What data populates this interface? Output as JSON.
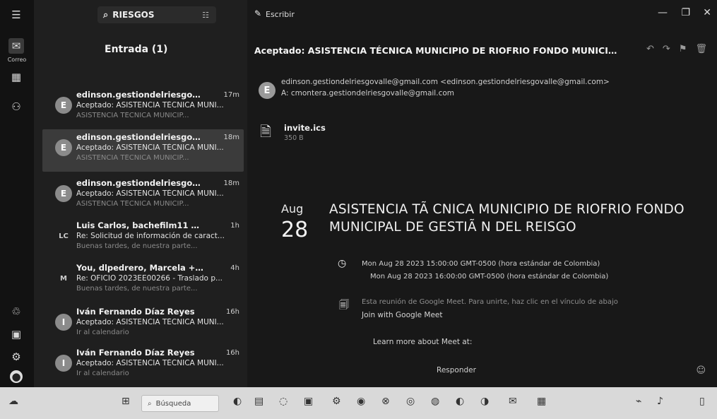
{
  "app": {
    "tab_title": "Escribir",
    "folder_title": "Entrada (1)",
    "rail_label": "Correo"
  },
  "search": {
    "value": "RIESGOS",
    "filter_label": "Filtro"
  },
  "list": [
    {
      "from": "edinson.gestiondelriesgovalle...",
      "time": "17m",
      "subject": "Aceptado: ASISTENCIA TÉCNICA MUNI...",
      "preview": "ASISTENCIA TÉCNICA MUNICIP...",
      "avatar": "E",
      "selected": false
    },
    {
      "from": "edinson.gestiondelriesgovalle...",
      "time": "18m",
      "subject": "Aceptado: ASISTENCIA TÉCNICA MUNI...",
      "preview": "ASISTENCIA TÉCNICA MUNICIP...",
      "avatar": "E",
      "selected": true
    },
    {
      "from": "edinson.gestiondelriesgovall...",
      "time": "18m",
      "subject": "Aceptado: ASISTENCIA TÉCNICA MUNI...",
      "preview": "ASISTENCIA TÉCNICA MUNICIP...",
      "avatar": "E",
      "selected": false
    },
    {
      "from": "Luis Carlos, bachefilm11 + 6",
      "time": "1h",
      "subject": "Re: Solicitud de información de caract...",
      "preview": "Buenas tardes, de nuestra parte...",
      "avatar": "LC",
      "selected": false
    },
    {
      "from": "You, dlpedrero, Marcela + 2",
      "time": "4h",
      "subject": "Re: OFICIO 2023EE00266 - Traslado p...",
      "preview": "Buenas tardes, de nuestra parte...",
      "avatar": "M",
      "selected": false
    },
    {
      "from": "Iván Fernando Díaz Reyes",
      "time": "16h",
      "subject": "Aceptado: ASISTENCIA TÉCNICA MUNI...",
      "preview": "Ir al calendario",
      "avatar": "I",
      "selected": false
    },
    {
      "from": "Iván Fernando Díaz Reyes",
      "time": "16h",
      "subject": "Aceptado: ASISTENCIA TÉCNICA MUNI...",
      "preview": "Ir al calendario",
      "avatar": "I",
      "selected": false
    }
  ],
  "message": {
    "subject": "Aceptado: ASISTENCIA TÉCNICA MUNICIPIO DE RIOFRIO FONDO MUNICIPAL...",
    "sender_avatar": "E",
    "from_line": "edinson.gestiondelriesgovalle@gmail.com <edinson.gestiondelriesgovalle@gmail.com>",
    "to_line": "A: cmontera.gestiondelriesgovalle@gmail.com",
    "attachment": {
      "name": "invite.ics",
      "size": "350 B"
    },
    "calendar": {
      "month": "Aug",
      "day": "28",
      "title": "ASISTENCIA TÃ CNICA MUNICIPIO DE RIOFRIO FONDO MUNICIPAL DE GESTIÃ N DEL REISGO",
      "time_start": "Mon Aug 28 2023 15:00:00 GMT-0500 (hora estándar de Colombia)",
      "time_end": "Mon Aug 28 2023 16:00:00 GMT-0500 (hora estándar de Colombia)",
      "meet_desc": "Esta reunión de Google Meet. Para unirte, haz clic en el vínculo de abajo",
      "meet_join": "Join with Google Meet",
      "meet_more": "Learn more about Meet at:"
    },
    "reply_label": "Responder"
  },
  "taskbar": {
    "search_label": "Búsqueda"
  }
}
